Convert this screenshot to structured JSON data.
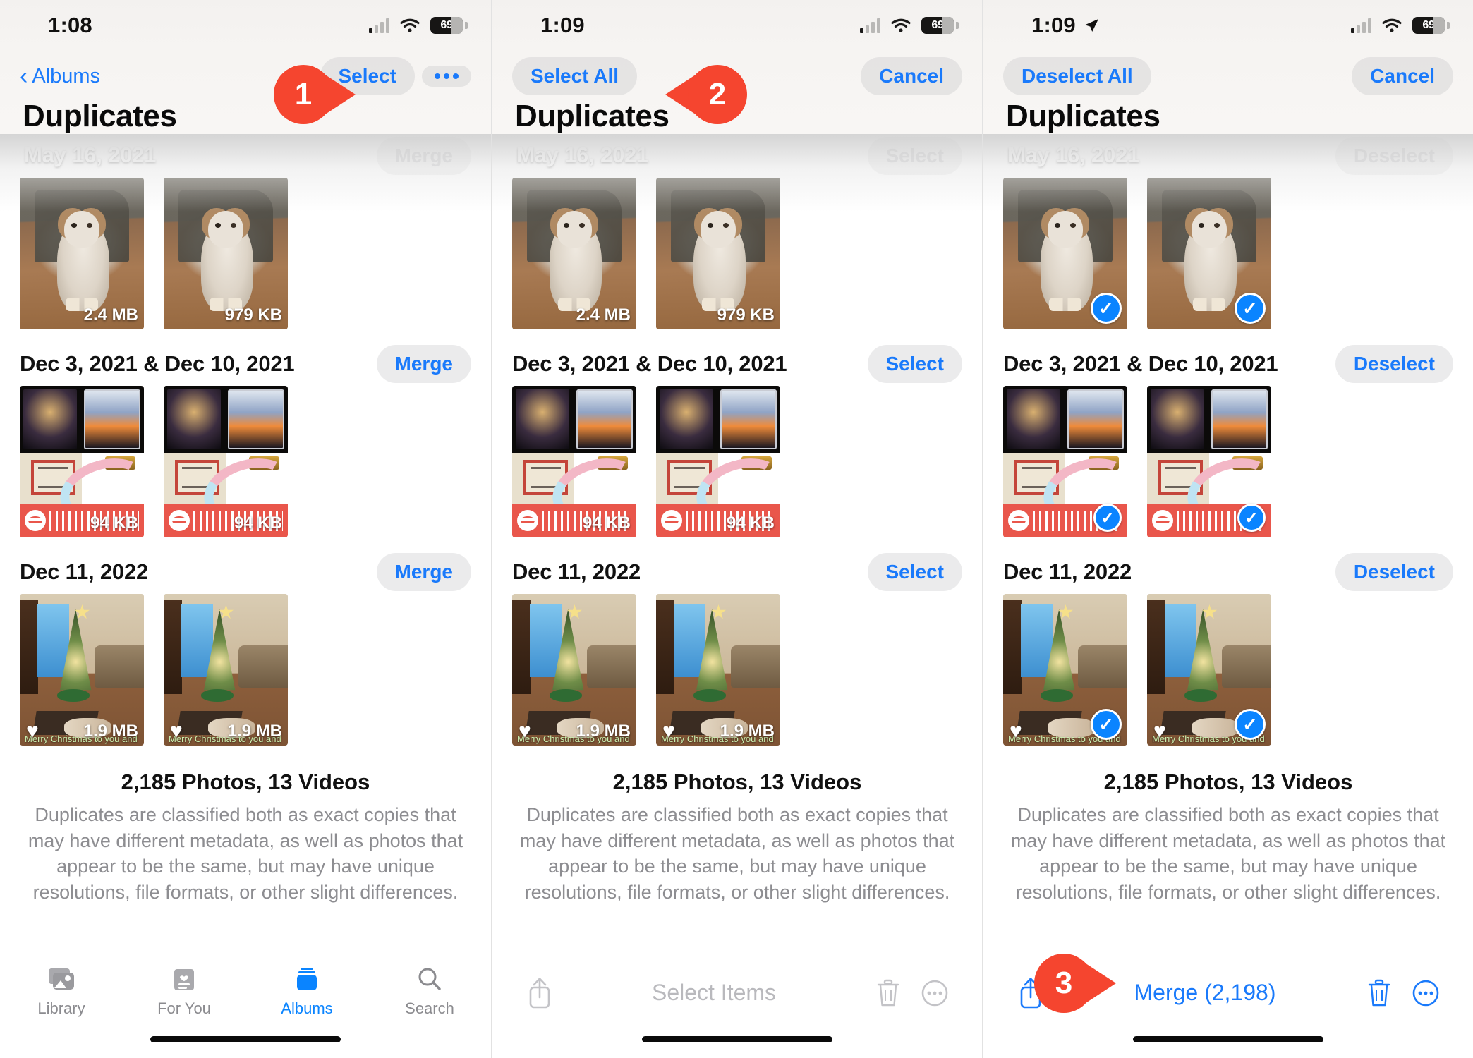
{
  "panels": [
    {
      "status": {
        "time": "1:08",
        "location_arrow": false,
        "battery": "69"
      },
      "nav": {
        "back_label": "Albums",
        "right_buttons": [
          "Select"
        ],
        "more_icon": "ellipsis-icon"
      },
      "title": "Duplicates",
      "row_action_label": "Merge",
      "bottom_type": "tabbar",
      "callout": {
        "number": "1"
      }
    },
    {
      "status": {
        "time": "1:09",
        "location_arrow": false,
        "battery": "69"
      },
      "nav": {
        "left_button": "Select All",
        "right_button": "Cancel"
      },
      "title": "Duplicates",
      "row_action_label": "Select",
      "bottom_type": "actionbar",
      "action_label": "Select Items",
      "action_active": false,
      "callout": {
        "number": "2"
      }
    },
    {
      "status": {
        "time": "1:09",
        "location_arrow": true,
        "battery": "69"
      },
      "nav": {
        "left_button": "Deselect All",
        "right_button": "Cancel"
      },
      "title": "Duplicates",
      "row_action_label": "Deselect",
      "bottom_type": "actionbar",
      "action_label": "Merge (2,198)",
      "action_active": true,
      "selected": true,
      "callout": {
        "number": "3"
      }
    }
  ],
  "groups": [
    {
      "date": "May 16, 2021",
      "overlay_date": true,
      "art": "dog",
      "photos": [
        {
          "size": "2.4 MB",
          "favorite": false
        },
        {
          "size": "979 KB",
          "favorite": false
        }
      ]
    },
    {
      "date": "Dec 3, 2021 & Dec 10, 2021",
      "overlay_date": false,
      "art": "album",
      "photos": [
        {
          "size": "94 KB",
          "favorite": false
        },
        {
          "size": "94 KB",
          "favorite": false
        }
      ]
    },
    {
      "date": "Dec 11, 2022",
      "overlay_date": false,
      "art": "xmas",
      "photos": [
        {
          "size": "1.9 MB",
          "favorite": true
        },
        {
          "size": "1.9 MB",
          "favorite": true
        }
      ]
    }
  ],
  "photo_caption": "Merry Christmas to you and yours",
  "summary": {
    "count": "2,185 Photos, 13 Videos",
    "description": "Duplicates are classified both as exact copies that may have different metadata, as well as photos that appear to be the same, but may have unique resolutions, file formats, or other slight differences."
  },
  "tabs": [
    {
      "label": "Library",
      "icon": "photos-library-icon",
      "active": false
    },
    {
      "label": "For You",
      "icon": "for-you-icon",
      "active": false
    },
    {
      "label": "Albums",
      "icon": "albums-icon",
      "active": true
    },
    {
      "label": "Search",
      "icon": "search-icon",
      "active": false
    }
  ],
  "action_icons": {
    "share": "share-icon",
    "trash": "trash-icon",
    "more": "more-circle-icon"
  },
  "colors": {
    "accent_blue": "#1a7afb",
    "callout_red": "#f5452f",
    "check_blue": "#0a84ff"
  }
}
